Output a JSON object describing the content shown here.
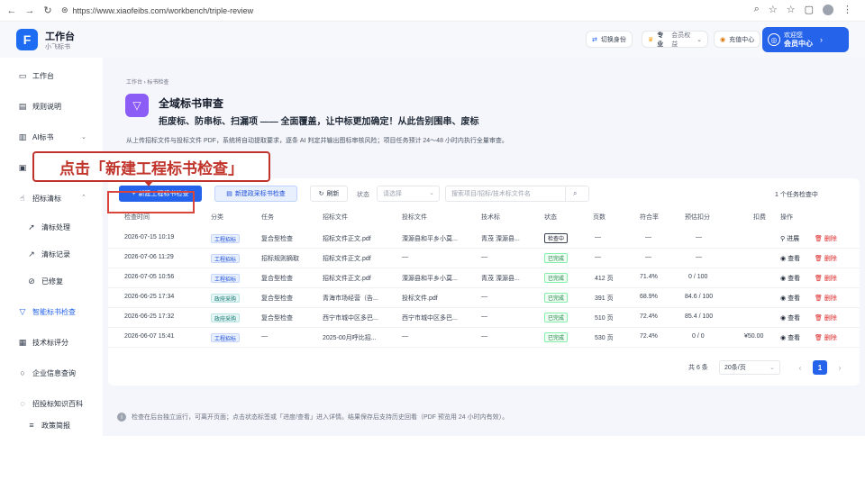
{
  "browser": {
    "url": "https://www.xiaofeibs.com/workbench/triple-review"
  },
  "app": {
    "logo": "F",
    "title": "工作台",
    "subtitle": "小飞标书"
  },
  "header": {
    "switch_label": "切换身份",
    "member_label": "会员权益",
    "member_badge": "专业",
    "member_action": "充值中心",
    "user_greeting": "欢迎您",
    "user_action": "会员中心"
  },
  "sidebar": {
    "items": [
      {
        "label": "工作台",
        "icon": "monitor-icon"
      },
      {
        "label": "规则说明",
        "icon": "document-icon"
      },
      {
        "label": "AI标书",
        "icon": "book-icon",
        "caret": "⌄"
      },
      {
        "label": "",
        "icon": "folder-icon"
      },
      {
        "label": "招标清标",
        "icon": "hand-icon",
        "caret": "⌃"
      },
      {
        "label": "清标处理",
        "icon": "send-icon"
      },
      {
        "label": "清标记录",
        "icon": "chart-icon"
      },
      {
        "label": "已修复",
        "icon": "check-circle-icon"
      },
      {
        "label": "智能标书检查",
        "icon": "filter-icon",
        "active": true
      },
      {
        "label": "技术标评分",
        "icon": "grade-icon"
      },
      {
        "label": "企业信息查询",
        "icon": "search-icon"
      },
      {
        "label": "招投标知识百科",
        "icon": "info-icon"
      },
      {
        "label": "政策简报",
        "icon": "list-icon"
      }
    ]
  },
  "page": {
    "breadcrumb": "工作台 › 标书检查",
    "title": "全域标书审查",
    "subtitle": "拒废标、防串标、扫漏项 —— 全面覆盖，让中标更加确定！从此告别围串、废标",
    "description": "从上传招标文件与投标文件 PDF，系统将自动提取要求，逐条 AI 判定并输出图标审核风险；项目任务预计 24～48 小时内执行全量审查。"
  },
  "toolbar": {
    "new_engineering": "新建工程标书检查",
    "new_government": "新建政采标书检查",
    "refresh": "刷新",
    "status_label": "状态",
    "status_placeholder": "请选择",
    "search_placeholder": "搜索项目/招标/技术标文件名",
    "task_count": "1 个任务检查中"
  },
  "table": {
    "headers": [
      "检查时间",
      "分类",
      "任务",
      "招标文件",
      "投标文件",
      "技术标",
      "状态",
      "页数",
      "符合率",
      "预估扣分",
      "扣费",
      "操作"
    ],
    "rows": [
      {
        "time": "2026-07-15 10:19",
        "category": "工程招标",
        "cat_type": "blue",
        "task": "复合型检查",
        "tender": "招标文件正文.pdf",
        "bid": "溧源县和平乡小莫...",
        "tech": "青茂 溧源县...",
        "status": "检查中",
        "status_type": "run",
        "pages": "—",
        "rate": "—",
        "score": "—",
        "fee": "",
        "view": "进展",
        "delete": "删除"
      },
      {
        "time": "2026-07-06 11:29",
        "category": "工程招标",
        "cat_type": "blue",
        "task": "招标规则摘取",
        "tender": "招标文件正文.pdf",
        "bid": "—",
        "tech": "—",
        "status": "已完成",
        "status_type": "done",
        "pages": "—",
        "rate": "—",
        "score": "—",
        "fee": "",
        "view": "查看",
        "delete": "删除"
      },
      {
        "time": "2026-07-05 10:56",
        "category": "工程招标",
        "cat_type": "blue",
        "task": "复合型检查",
        "tender": "招标文件正文.pdf",
        "bid": "溧源县和平乡小莫...",
        "tech": "青茂 溧源县...",
        "status": "已完成",
        "status_type": "done",
        "pages": "412 页",
        "rate": "71.4%",
        "score": "0 / 100",
        "fee": "",
        "view": "查看",
        "delete": "删除"
      },
      {
        "time": "2026-06-25 17:34",
        "category": "政府采购",
        "cat_type": "teal",
        "task": "复合型检查",
        "tender": "青海市场经营（告...",
        "bid": "投标文件.pdf",
        "tech": "—",
        "status": "已完成",
        "status_type": "done",
        "pages": "391 页",
        "rate": "68.9%",
        "score": "84.6 / 100",
        "fee": "",
        "view": "查看",
        "delete": "删除"
      },
      {
        "time": "2026-06-25 17:32",
        "category": "政府采购",
        "cat_type": "teal",
        "task": "复合型检查",
        "tender": "西宁市城中区多巴...",
        "bid": "西宁市城中区多巴...",
        "tech": "—",
        "status": "已完成",
        "status_type": "done",
        "pages": "510 页",
        "rate": "72.4%",
        "score": "85.4 / 100",
        "fee": "",
        "view": "查看",
        "delete": "删除"
      },
      {
        "time": "2026-06-07 15:41",
        "category": "工程招标",
        "cat_type": "blue",
        "task": "—",
        "tender": "2025-00月呼比招...",
        "bid": "—",
        "tech": "—",
        "status": "已完成",
        "status_type": "done",
        "pages": "530 页",
        "rate": "72.4%",
        "score": "0 / 0",
        "fee": "¥50.00",
        "view": "查看",
        "delete": "删除"
      }
    ]
  },
  "pagination": {
    "total": "共 6 条",
    "page_size": "20条/页",
    "current": "1",
    "prev": "‹",
    "next": "›"
  },
  "footer_note": "检查在后台独立运行，可离开页面；点击状态标签或「进度/查看」进入详情。结果保存后支持历史回看（PDF 预览用 24 小时内有效）。",
  "annotation": {
    "text": "点击「新建工程标书检查」"
  },
  "colors": {
    "primary": "#2563eb",
    "annotation": "#c0342b",
    "accent_purple": "#8b5cf6"
  }
}
